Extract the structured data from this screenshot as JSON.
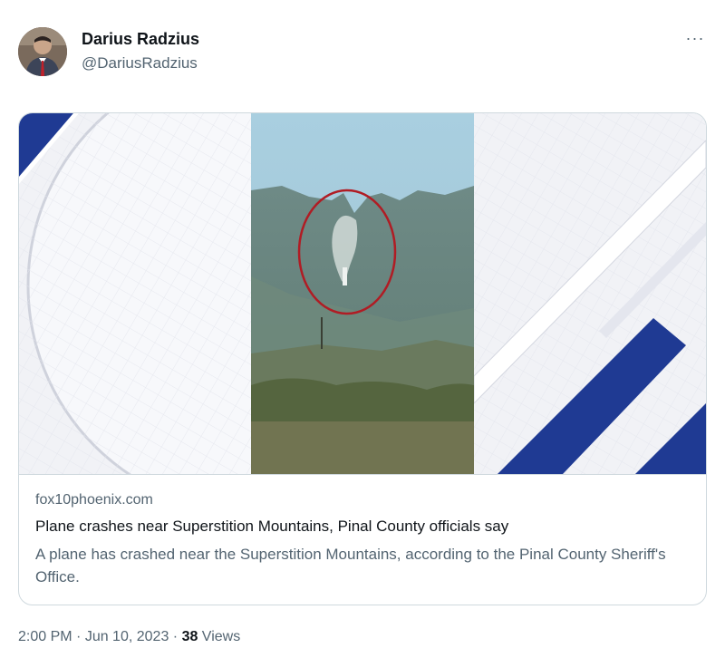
{
  "tweet": {
    "author_name": "Darius Radzius",
    "author_handle": "@DariusRadzius",
    "more_label": "···",
    "time": "2:00 PM",
    "separator": " · ",
    "date": "Jun 10, 2023",
    "views_count": "38",
    "views_label": " Views"
  },
  "link_card": {
    "domain": "fox10phoenix.com",
    "title": "Plane crashes near Superstition Mountains, Pinal County officials say",
    "description": "A plane has crashed near the Superstition Mountains, according to the Pinal County Sheriff's Office."
  },
  "colors": {
    "accent_blue": "#1f3a93",
    "annotation_circle": "#b01c24",
    "text_secondary": "#536471"
  }
}
